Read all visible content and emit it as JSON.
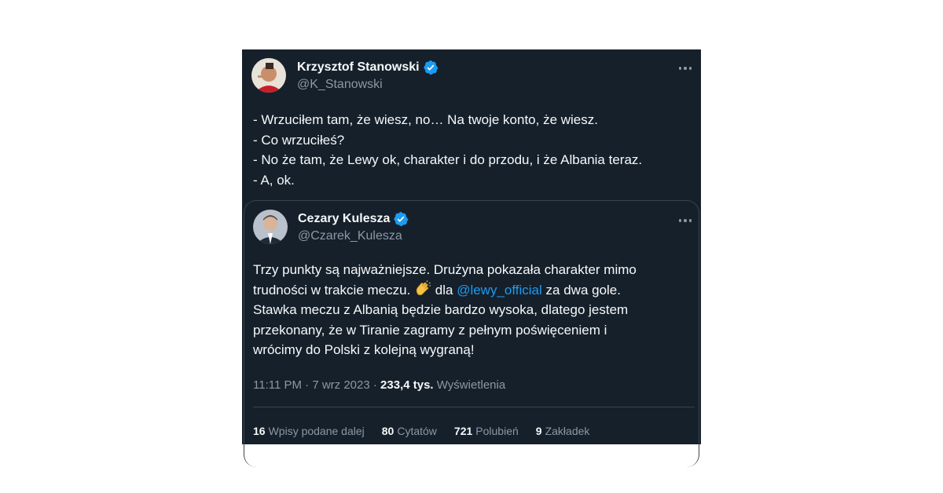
{
  "tweet": {
    "author_name": "Krzysztof Stanowski",
    "author_handle": "@K_Stanowski",
    "lines": [
      "- Wrzuciłem tam, że wiesz, no… Na twoje konto, że wiesz.",
      "- Co wrzuciłeś?",
      "- No że tam, że Lewy ok, charakter i do przodu, i że Albania teraz.",
      "- A, ok."
    ]
  },
  "quoted": {
    "author_name": "Cezary Kulesza",
    "author_handle": "@Czarek_Kulesza",
    "line1": "Trzy punkty są najważniejsze. Drużyna pokazała charakter mimo",
    "line2_a": "trudności w trakcie meczu.",
    "line2_b": "dla",
    "mention": "@lewy_official",
    "line2_c": "za dwa gole.",
    "line3": "Stawka meczu z Albanią będzie bardzo wysoka, dlatego jestem",
    "line4": "przekonany, że w Tiranie zagramy z pełnym poświęceniem i",
    "line5": "wrócimy do Polski z kolejną wygraną!",
    "emoji_icon": "clapping-hands-icon"
  },
  "meta": {
    "time": "11:11 PM",
    "sep1": "·",
    "date": "7 wrz 2023",
    "sep2": "·",
    "views_count": "233,4 tys.",
    "views_label": "Wyświetlenia"
  },
  "stats": [
    {
      "count": "16",
      "label": "Wpisy podane dalej"
    },
    {
      "count": "80",
      "label": "Cytatów"
    },
    {
      "count": "721",
      "label": "Polubień"
    },
    {
      "count": "9",
      "label": "Zakładek"
    }
  ],
  "colors": {
    "background": "#15202b",
    "text": "#f7f9f9",
    "secondary": "#8b98a5",
    "accent": "#1d9bf0",
    "border": "#38444d"
  }
}
